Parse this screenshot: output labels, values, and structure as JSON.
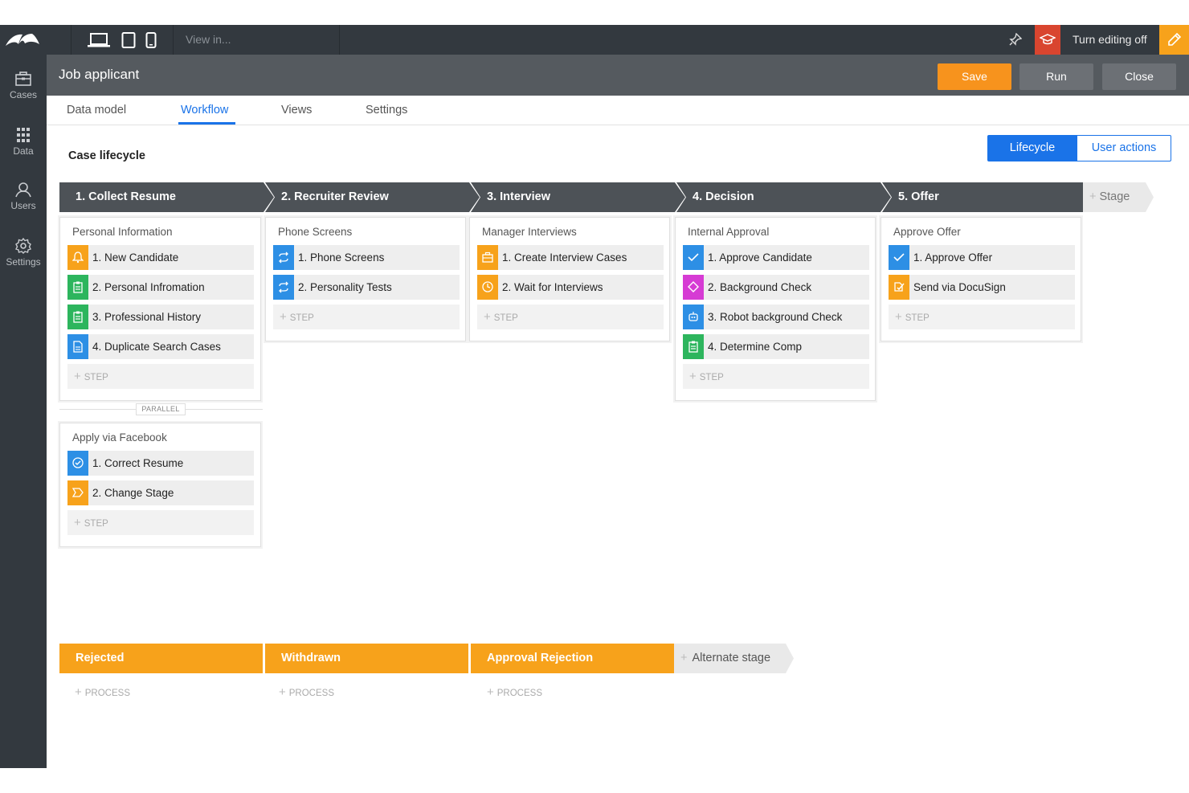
{
  "topbar": {
    "view_in": "View in...",
    "turn_editing": "Turn editing off"
  },
  "leftnav": [
    {
      "label": "Cases",
      "icon": "cases-icon"
    },
    {
      "label": "Data",
      "icon": "grid-icon"
    },
    {
      "label": "Users",
      "icon": "users-icon"
    },
    {
      "label": "Settings",
      "icon": "gear-icon"
    }
  ],
  "header": {
    "title": "Job applicant",
    "save": "Save",
    "run": "Run",
    "close": "Close"
  },
  "tabs": [
    "Data model",
    "Workflow",
    "Views",
    "Settings"
  ],
  "active_tab": "Workflow",
  "lifecycle": {
    "title": "Case lifecycle",
    "toggle_lifecycle": "Lifecycle",
    "toggle_user_actions": "User actions",
    "add_stage": "Stage",
    "stages": [
      {
        "name": "1. Collect Resume"
      },
      {
        "name": "2. Recruiter Review"
      },
      {
        "name": "3. Interview"
      },
      {
        "name": "4. Decision"
      },
      {
        "name": "5. Offer"
      }
    ],
    "processes": [
      {
        "title": "Personal Information",
        "steps": [
          {
            "label": "1. New Candidate",
            "icon": "bell-icon",
            "color": "#f7a21b"
          },
          {
            "label": "2. Personal Infromation",
            "icon": "clipboard-icon",
            "color": "#2db55d"
          },
          {
            "label": "3. Professional History",
            "icon": "clipboard-icon",
            "color": "#2db55d"
          },
          {
            "label": "4. Duplicate Search Cases",
            "icon": "document-icon",
            "color": "#2d8fe5"
          }
        ]
      },
      {
        "title": "Phone Screens",
        "steps": [
          {
            "label": "1. Phone Screens",
            "icon": "loop-icon",
            "color": "#2d8fe5"
          },
          {
            "label": "2. Personality Tests",
            "icon": "loop-icon",
            "color": "#2d8fe5"
          }
        ]
      },
      {
        "title": "Manager Interviews",
        "steps": [
          {
            "label": "1. Create Interview Cases",
            "icon": "briefcase-icon",
            "color": "#f7a21b"
          },
          {
            "label": "2. Wait for Interviews",
            "icon": "clock-icon",
            "color": "#f7a21b"
          }
        ]
      },
      {
        "title": "Internal Approval",
        "steps": [
          {
            "label": "1. Approve Candidate",
            "icon": "check-icon",
            "color": "#2d8fe5"
          },
          {
            "label": "2. Background Check",
            "icon": "diamond-icon",
            "color": "#d63bd4"
          },
          {
            "label": "3. Robot background Check",
            "icon": "robot-icon",
            "color": "#2d8fe5"
          },
          {
            "label": "4. Determine Comp",
            "icon": "clipboard-icon",
            "color": "#2db55d"
          }
        ]
      },
      {
        "title": "Approve Offer",
        "steps": [
          {
            "label": "1. Approve Offer",
            "icon": "check-icon",
            "color": "#2d8fe5"
          },
          {
            "label": "Send via DocuSign",
            "icon": "docusign-icon",
            "color": "#f7a21b"
          }
        ]
      },
      {
        "title": "Apply via Facebook",
        "steps": [
          {
            "label": "1. Correct Resume",
            "icon": "check-circle-icon",
            "color": "#2d8fe5"
          },
          {
            "label": "2. Change Stage",
            "icon": "stage-icon",
            "color": "#f7a21b"
          }
        ]
      }
    ],
    "add_step": "STEP",
    "parallel": "PARALLEL",
    "alternate_stages": [
      {
        "name": "Rejected"
      },
      {
        "name": "Withdrawn"
      },
      {
        "name": "Approval Rejection"
      }
    ],
    "add_alternate": "Alternate stage",
    "add_process": "PROCESS"
  }
}
